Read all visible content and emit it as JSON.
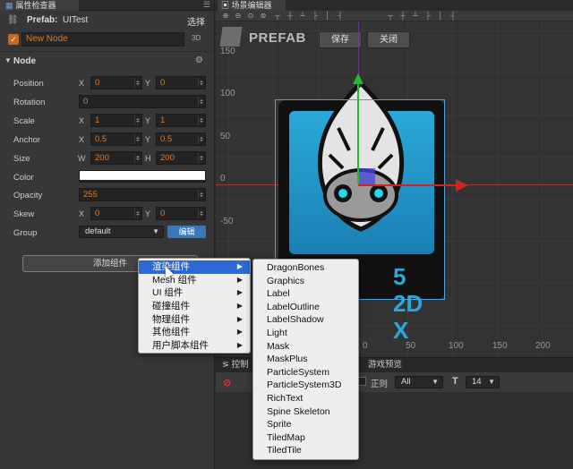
{
  "inspector": {
    "tab_label": "属性检查器",
    "prefab_label": "Prefab:",
    "prefab_name": "UITest",
    "select_label": "选择",
    "node_name": "New Node",
    "dimension_badge": "3D",
    "section_title": "Node",
    "props": {
      "position": {
        "label": "Position",
        "x_axis": "X",
        "y_axis": "Y",
        "x": "0",
        "y": "0"
      },
      "rotation": {
        "label": "Rotation",
        "value": "0"
      },
      "scale": {
        "label": "Scale",
        "x_axis": "X",
        "y_axis": "Y",
        "x": "1",
        "y": "1"
      },
      "anchor": {
        "label": "Anchor",
        "x_axis": "X",
        "y_axis": "Y",
        "x": "0.5",
        "y": "0.5"
      },
      "size": {
        "label": "Size",
        "w_axis": "W",
        "h_axis": "H",
        "w": "200",
        "h": "200"
      },
      "color": {
        "label": "Color",
        "value": "#ffffff"
      },
      "opacity": {
        "label": "Opacity",
        "value": "255"
      },
      "skew": {
        "label": "Skew",
        "x_axis": "X",
        "y_axis": "Y",
        "x": "0",
        "y": "0"
      },
      "group": {
        "label": "Group",
        "value": "default",
        "edit_label": "编辑"
      }
    },
    "add_component_label": "添加组件"
  },
  "scene": {
    "tab_label": "场景编辑器",
    "prefab_title": "PREFAB",
    "save_label": "保存",
    "close_label": "关闭",
    "y_ticks": [
      "150",
      "100",
      "50",
      "0",
      "-50"
    ],
    "x_ticks": [
      "0",
      "50",
      "100",
      "150",
      "200"
    ],
    "logo_text": "5 2D X"
  },
  "console": {
    "tab_console": "控制",
    "tab_preview": "游戏预览",
    "regex_label": "正则",
    "level_value": "All",
    "font_size_value": "14"
  },
  "context_menu": {
    "items": [
      {
        "label": "渲染组件",
        "active": true
      },
      {
        "label": "Mesh 组件"
      },
      {
        "label": "UI 组件"
      },
      {
        "label": "碰撞组件"
      },
      {
        "label": "物理组件"
      },
      {
        "label": "其他组件"
      },
      {
        "label": "用户脚本组件"
      }
    ],
    "submenu": [
      "DragonBones",
      "Graphics",
      "Label",
      "LabelOutline",
      "LabelShadow",
      "Light",
      "Mask",
      "MaskPlus",
      "ParticleSystem",
      "ParticleSystem3D",
      "RichText",
      "Spine Skeleton",
      "Sprite",
      "TiledMap",
      "TiledTile"
    ]
  },
  "colors": {
    "accent_orange": "#c86a1e",
    "value_orange": "#e07a28",
    "menu_highlight": "#2c68d6",
    "edit_button": "#3a78b8"
  }
}
